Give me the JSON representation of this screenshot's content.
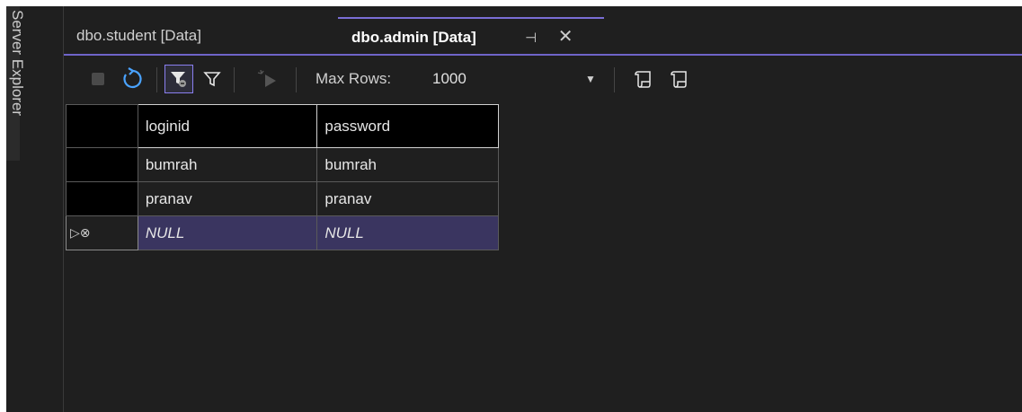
{
  "sidebar": {
    "server_explorer_label": "Server Explorer"
  },
  "tabs": [
    {
      "label": "dbo.student [Data]",
      "active": false
    },
    {
      "label": "dbo.admin [Data]",
      "active": true
    }
  ],
  "tab_actions": {
    "pin_glyph": "⊣",
    "close_glyph": "✕"
  },
  "toolbar": {
    "max_rows_label": "Max Rows:",
    "max_rows_value": "1000",
    "accent_color": "#7a6ed6"
  },
  "grid": {
    "columns": [
      "loginid",
      "password"
    ],
    "rows": [
      [
        "bumrah",
        "bumrah"
      ],
      [
        "pranav",
        "pranav"
      ]
    ],
    "new_row": [
      "NULL",
      "NULL"
    ],
    "new_row_marker": "▷⊗"
  }
}
